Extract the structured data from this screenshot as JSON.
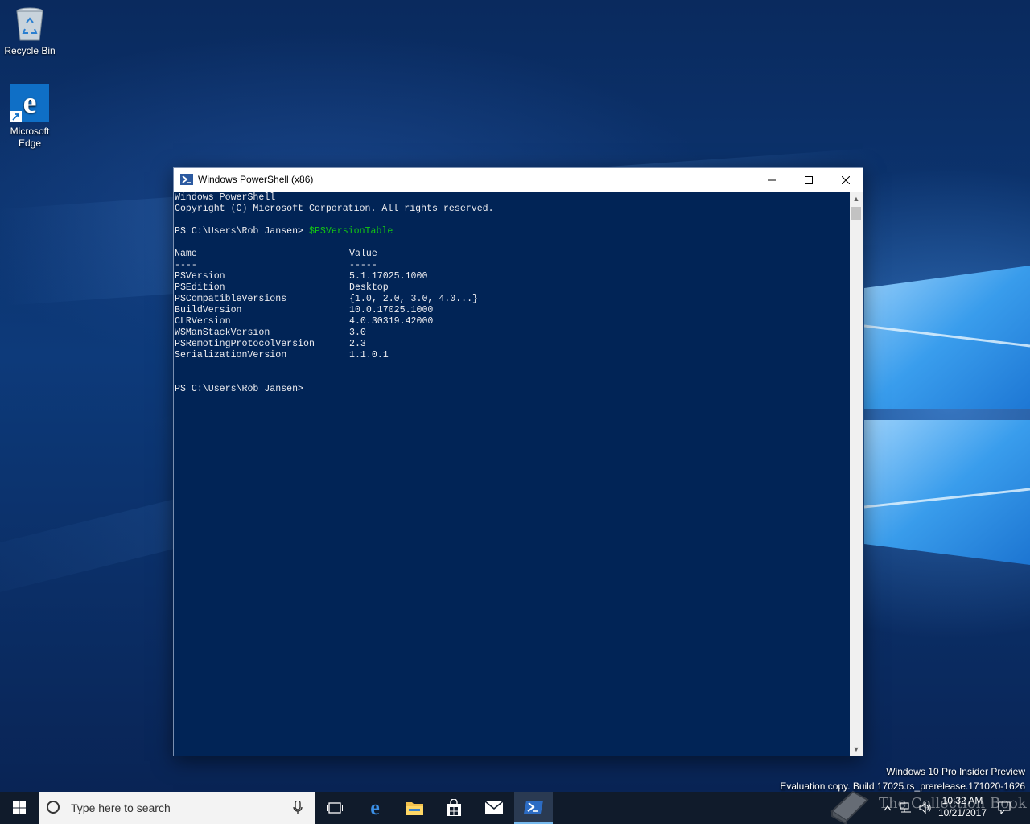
{
  "desktop": {
    "icons": [
      {
        "label": "Recycle Bin"
      },
      {
        "label": "Microsoft Edge"
      }
    ]
  },
  "window": {
    "title": "Windows PowerShell (x86)",
    "controls": {
      "minimize": "—",
      "maximize": "☐",
      "close": "✕"
    }
  },
  "console": {
    "banner": [
      "Windows PowerShell",
      "Copyright (C) Microsoft Corporation. All rights reserved."
    ],
    "prompt": "PS C:\\Users\\Rob Jansen> ",
    "command": "$PSVersionTable",
    "table": {
      "header": {
        "name": "Name",
        "value": "Value"
      },
      "underline": {
        "name": "----",
        "value": "-----"
      },
      "rows": [
        {
          "name": "PSVersion",
          "value": "5.1.17025.1000"
        },
        {
          "name": "PSEdition",
          "value": "Desktop"
        },
        {
          "name": "PSCompatibleVersions",
          "value": "{1.0, 2.0, 3.0, 4.0...}"
        },
        {
          "name": "BuildVersion",
          "value": "10.0.17025.1000"
        },
        {
          "name": "CLRVersion",
          "value": "4.0.30319.42000"
        },
        {
          "name": "WSManStackVersion",
          "value": "3.0"
        },
        {
          "name": "PSRemotingProtocolVersion",
          "value": "2.3"
        },
        {
          "name": "SerializationVersion",
          "value": "1.1.0.1"
        }
      ]
    },
    "final_prompt": "PS C:\\Users\\Rob Jansen>"
  },
  "watermark": {
    "line1": "Windows 10 Pro Insider Preview",
    "line2": "Evaluation copy. Build 17025.rs_prerelease.171020-1626"
  },
  "taskbar": {
    "search_placeholder": "Type here to search",
    "clock": {
      "time": "10:32 AM",
      "date": "10/21/2017"
    },
    "brand_watermark": "The Collection Book"
  },
  "colors": {
    "console_bg": "#012456",
    "console_fg": "#eeedf0",
    "command": "#13c613",
    "taskbar_bg": "#101b2b",
    "accent": "#76b9ed"
  }
}
